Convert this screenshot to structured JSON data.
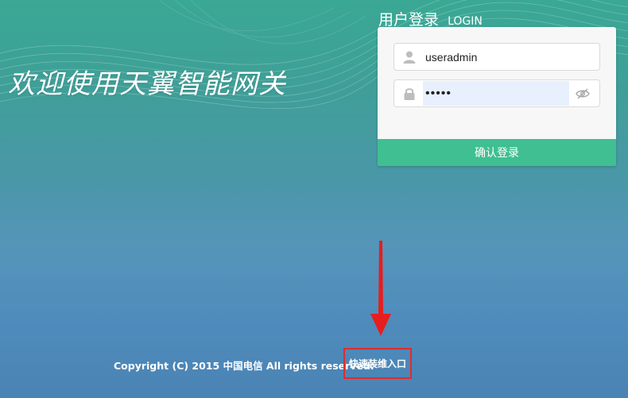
{
  "welcome_text": "欢迎使用天翼智能网关",
  "login": {
    "title_cn": "用户登录",
    "title_en": "LOGIN",
    "username": {
      "icon": "user-icon",
      "value": "useradmin"
    },
    "password": {
      "icon": "lock-icon",
      "value": "•••••",
      "toggle_icon": "eye-slash-icon"
    },
    "submit_label": "确认登录"
  },
  "footer": {
    "copyright": "Copyright (C) 2015 中国电信 All rights reserved.",
    "quick_link": "快速装维入口"
  },
  "annotation": {
    "arrow_color": "#e61e1e",
    "box_color": "#e12b2b"
  },
  "colors": {
    "accent": "#3fbf92"
  }
}
